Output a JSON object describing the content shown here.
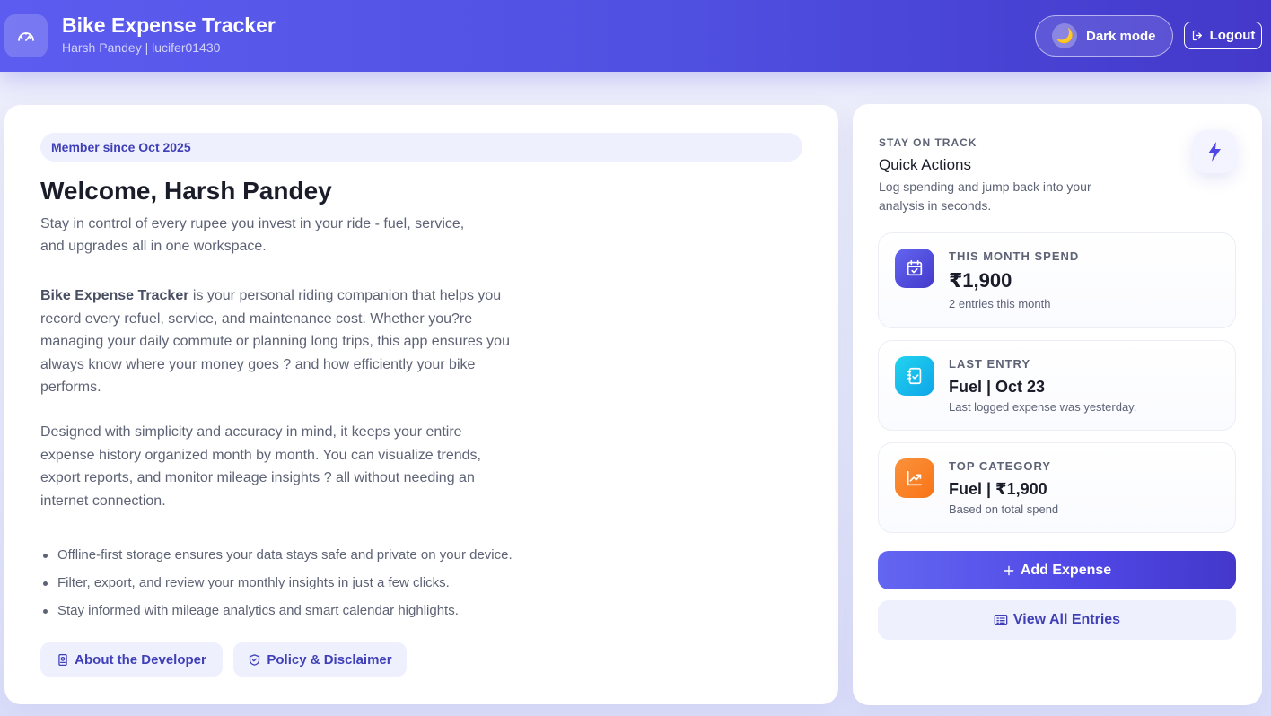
{
  "header": {
    "title": "Bike Expense Tracker",
    "subtitle": "Harsh Pandey | lucifer01430",
    "dark_mode_label": "Dark mode",
    "logout_label": "Logout",
    "brand_icon": "speedometer-icon",
    "accent": "#4f46e5"
  },
  "intro": {
    "member_since": "Member since Oct 2025",
    "welcome": "Welcome, Harsh Pandey",
    "tagline": "Stay in control of every rupee you invest in your ride - fuel, service, and upgrades all in one workspace.",
    "para1_bold": "Bike Expense Tracker",
    "para1_rest": " is your personal riding companion that helps you record every refuel, service, and maintenance cost. Whether you?re managing your daily commute or planning long trips, this app ensures you always know where your money goes ? and how efficiently your bike performs.",
    "para2": "Designed with simplicity and accuracy in mind, it keeps your entire expense history organized month by month. You can visualize trends, export reports, and monitor mileage insights ? all without needing an internet connection.",
    "features": [
      "Offline-first storage ensures your data stays safe and private on your device.",
      "Filter, export, and review your monthly insights in just a few clicks.",
      "Stay informed with mileage analytics and smart calendar highlights."
    ],
    "about_label": "About the Developer",
    "policy_label": "Policy & Disclaimer"
  },
  "quick_actions": {
    "eyebrow": "STAY ON TRACK",
    "title": "Quick Actions",
    "description": "Log spending and jump back into your analysis in seconds.",
    "stats": [
      {
        "label": "THIS MONTH SPEND",
        "value": "₹1,900",
        "note": "2 entries this month",
        "icon": "calendar-check-icon",
        "color": "#4f46e5"
      },
      {
        "label": "LAST ENTRY",
        "value": "Fuel | Oct 23",
        "note": "Last logged expense was yesterday.",
        "icon": "receipt-check-icon",
        "color": "#0ea5e9"
      },
      {
        "label": "TOP CATEGORY",
        "value": "Fuel | ₹1,900",
        "note": "Based on total spend",
        "icon": "trend-up-icon",
        "color": "#f97316"
      }
    ],
    "add_label": "Add Expense",
    "view_label": "View All Entries"
  }
}
